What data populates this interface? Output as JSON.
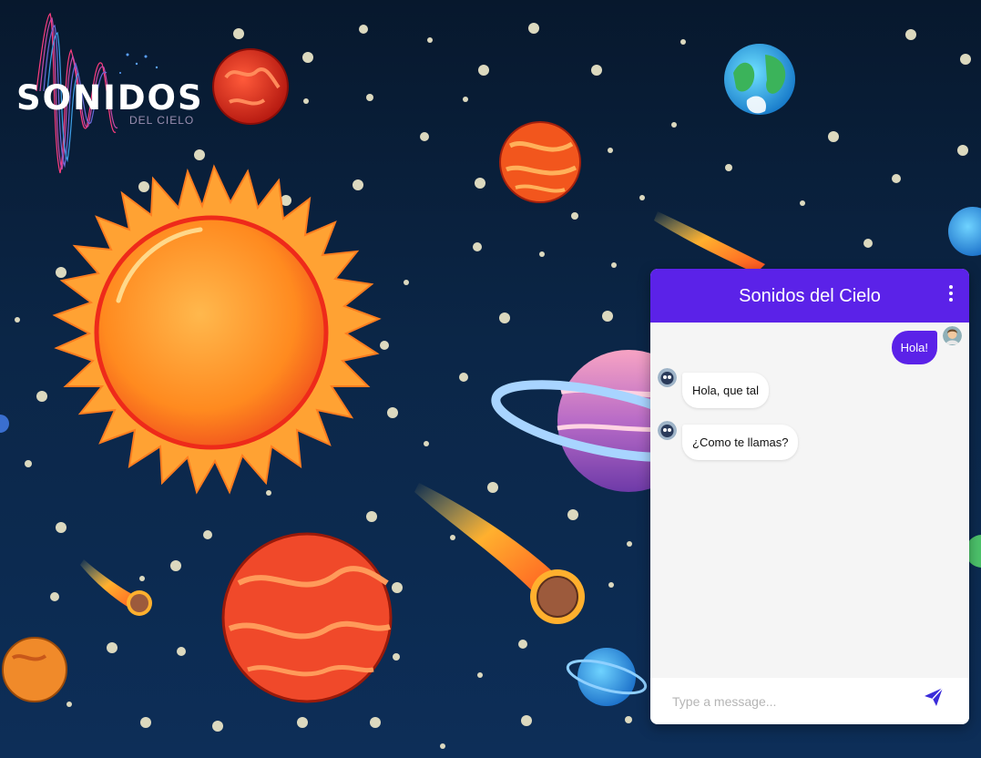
{
  "logo": {
    "title": "SONIDOS",
    "subtitle": "DEL CIELO"
  },
  "chat": {
    "title": "Sonidos del Cielo",
    "menu_icon": "kebab-menu-icon",
    "colors": {
      "header": "#5b22e8",
      "user_bubble": "#5b22e8",
      "bot_bubble": "#ffffff",
      "send_icon": "#3a2bd9"
    },
    "messages": [
      {
        "sender": "user",
        "text": "Hola!"
      },
      {
        "sender": "bot",
        "text": "Hola, que tal"
      },
      {
        "sender": "bot",
        "text": "¿Como te llamas?"
      }
    ],
    "input": {
      "placeholder": "Type a message...",
      "value": ""
    },
    "send_icon": "paper-plane-icon"
  }
}
